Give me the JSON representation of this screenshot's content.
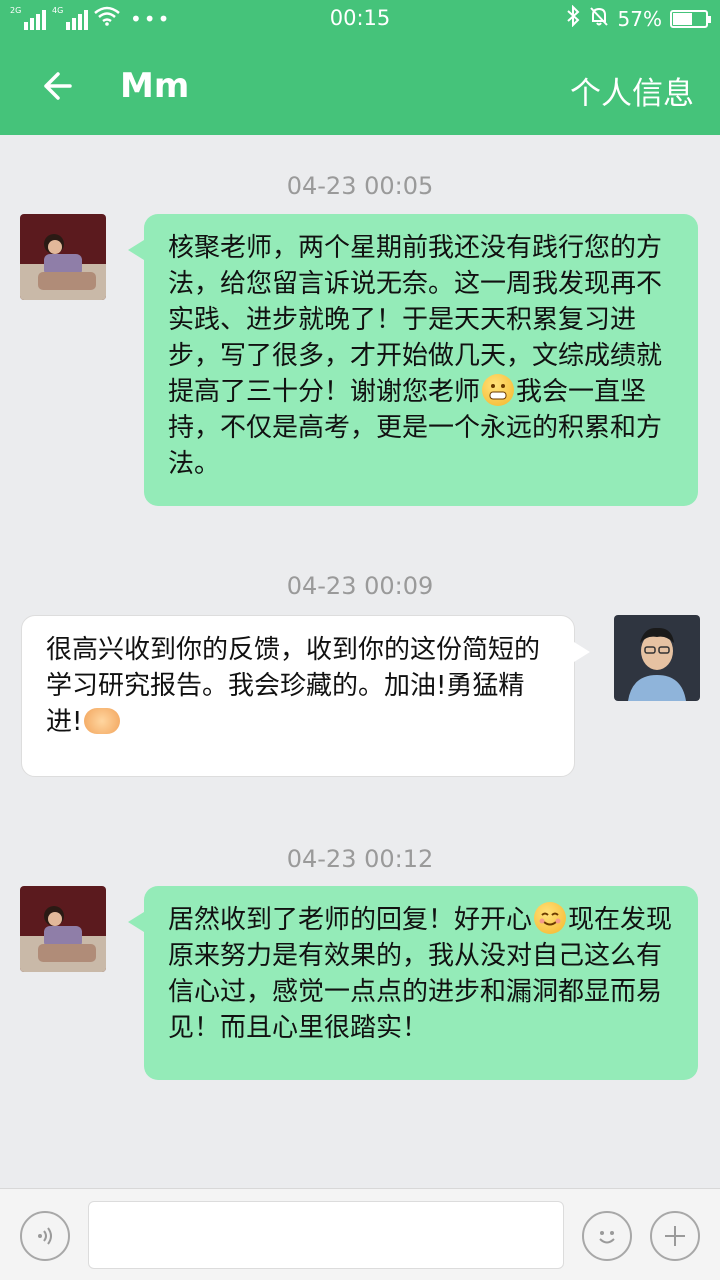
{
  "status_bar": {
    "network_left": "2G",
    "network_right": "4G",
    "more": "•••",
    "time": "00:15",
    "battery_percent": "57%",
    "battery_level": 0.57
  },
  "app_bar": {
    "title": "Mm",
    "profile_link": "个人信息"
  },
  "messages": [
    {
      "timestamp": "04-23 00:05",
      "side": "left",
      "text_1": "核聚老师，两个星期前我还没有践行您的方法，给您留言诉说无奈。这一周我发现再不实践、进步就晚了！于是天天积累复习进步，写了很多，才开始做几天，文综成绩就提高了三十分！谢谢您老师",
      "emoji": "grin-emoji",
      "text_2": "我会一直坚持，不仅是高考，更是一个永远的积累和方法。"
    },
    {
      "timestamp": "04-23 00:09",
      "side": "right",
      "text_1": "很高兴收到你的反馈，收到你的这份简短的学习研究报告。我会珍藏的。加油!勇猛精进!",
      "emoji": "handshake-emoji"
    },
    {
      "timestamp": "04-23 00:12",
      "side": "left",
      "text_1": "居然收到了老师的回复！好开心",
      "emoji": "smile-emoji",
      "text_2": "现在发现原来努力是有效果的，我从没对自己这么有信心过，感觉一点点的进步和漏洞都显而易见！而且心里很踏实！"
    }
  ],
  "input_bar": {
    "voice_icon": "voice-icon",
    "emoji_icon": "emoji-icon",
    "plus_icon": "plus-icon"
  },
  "colors": {
    "brand_green": "#45c37a",
    "bubble_green": "#94ebb8",
    "background": "#ebecee"
  }
}
